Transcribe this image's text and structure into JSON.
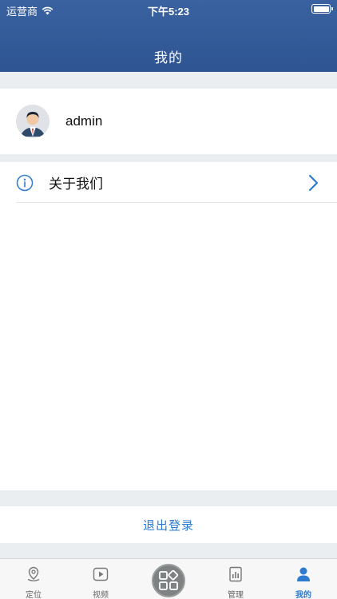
{
  "status_bar": {
    "carrier": "运营商",
    "time": "下午5:23",
    "battery_level": 1.0
  },
  "nav": {
    "title": "我的"
  },
  "profile": {
    "username": "admin",
    "avatar_icon": "user-avatar-icon"
  },
  "menu": {
    "items": [
      {
        "label": "关于我们",
        "icon": "info-icon"
      }
    ]
  },
  "logout": {
    "label": "退出登录"
  },
  "tabbar": {
    "tabs": [
      {
        "label": "定位",
        "icon": "location-icon",
        "active": false
      },
      {
        "label": "视频",
        "icon": "video-icon",
        "active": false
      },
      {
        "label": "",
        "icon": "apps-grid-icon",
        "active": false
      },
      {
        "label": "管理",
        "icon": "report-icon",
        "active": false
      },
      {
        "label": "我的",
        "icon": "person-icon",
        "active": true
      }
    ]
  },
  "colors": {
    "header": "#2e5592",
    "accent": "#2d7bd0",
    "background": "#eaeef0"
  }
}
